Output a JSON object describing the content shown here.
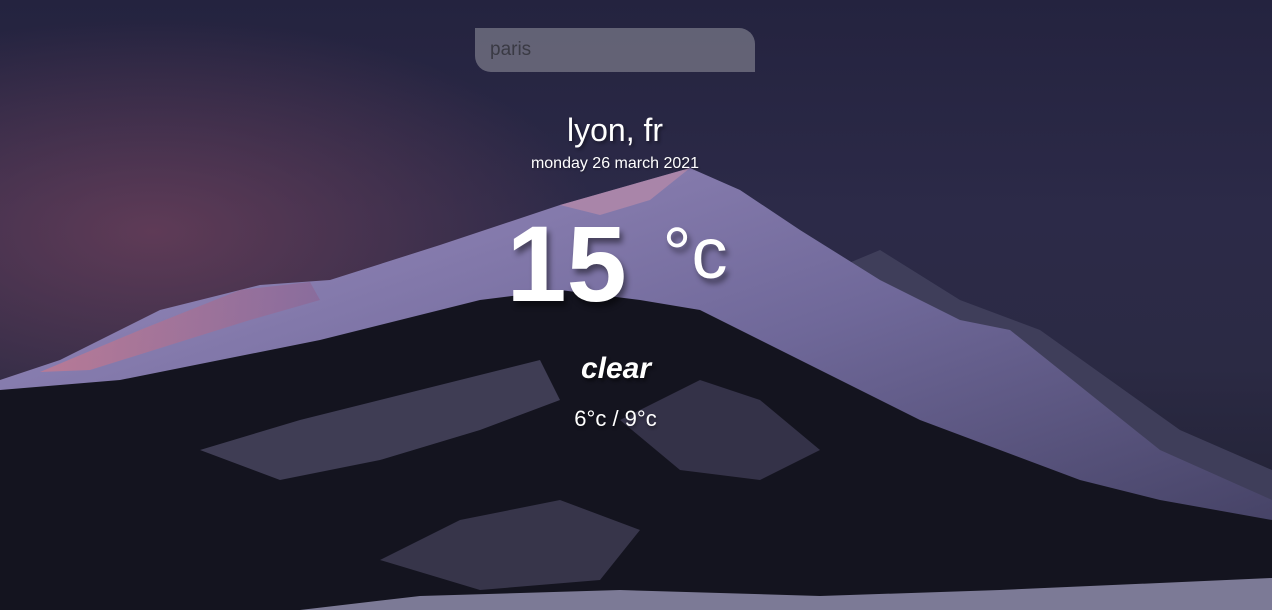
{
  "search": {
    "value": "paris"
  },
  "location": {
    "label": "lyon, fr",
    "date": "monday 26 march 2021"
  },
  "weather": {
    "temperature": "15",
    "unit": "°c",
    "condition": "clear",
    "range": "6°c / 9°c"
  },
  "colors": {
    "text": "#ffffff",
    "sky": "#24233f",
    "snow": "#c9c6e0",
    "alpenglow": "#c98aa0"
  },
  "background": {
    "subject": "snow-capped mountain at dusk"
  }
}
